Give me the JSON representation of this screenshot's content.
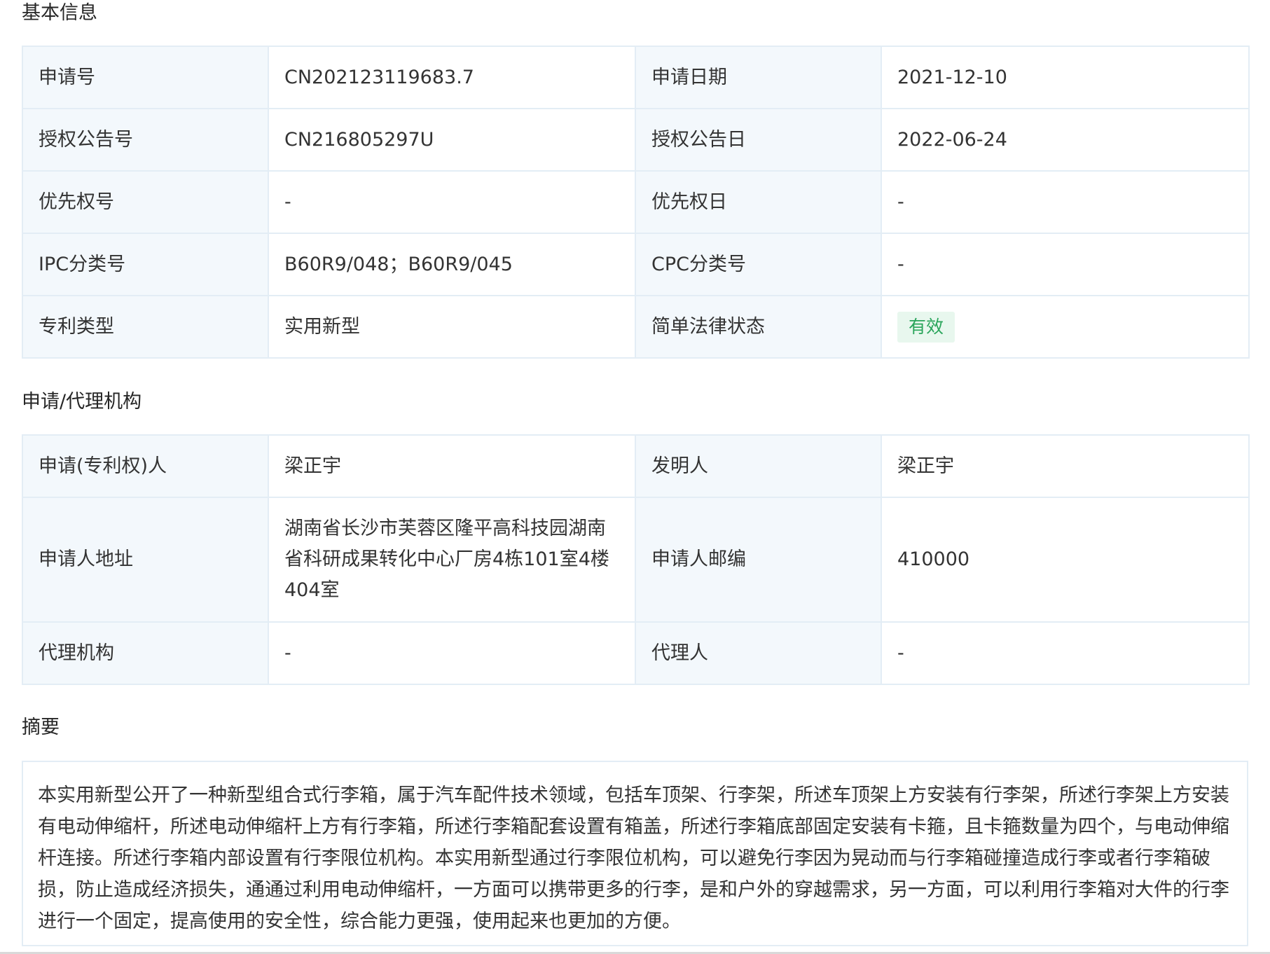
{
  "basic_info": {
    "title": "基本信息",
    "rows": [
      {
        "l1": "申请号",
        "v1": "CN202123119683.7",
        "l2": "申请日期",
        "v2": "2021-12-10"
      },
      {
        "l1": "授权公告号",
        "v1": "CN216805297U",
        "l2": "授权公告日",
        "v2": "2022-06-24"
      },
      {
        "l1": "优先权号",
        "v1": "-",
        "l2": "优先权日",
        "v2": "-"
      },
      {
        "l1": "IPC分类号",
        "v1": "B60R9/048；B60R9/045",
        "l2": "CPC分类号",
        "v2": "-"
      },
      {
        "l1": "专利类型",
        "v1": "实用新型",
        "l2": "简单法律状态",
        "v2": "有效"
      }
    ]
  },
  "agency_info": {
    "title": "申请/代理机构",
    "rows": [
      {
        "l1": "申请(专利权)人",
        "v1": "梁正宇",
        "l2": "发明人",
        "v2": "梁正宇"
      },
      {
        "l1": "申请人地址",
        "v1": "湖南省长沙市芙蓉区隆平高科技园湖南省科研成果转化中心厂房4栋101室4楼404室",
        "l2": "申请人邮编",
        "v2": "410000"
      },
      {
        "l1": "代理机构",
        "v1": "-",
        "l2": "代理人",
        "v2": "-"
      }
    ]
  },
  "abstract": {
    "title": "摘要",
    "text": "本实用新型公开了一种新型组合式行李箱，属于汽车配件技术领域，包括车顶架、行李架，所述车顶架上方安装有行李架，所述行李架上方安装有电动伸缩杆，所述电动伸缩杆上方有行李箱，所述行李箱配套设置有箱盖，所述行李箱底部固定安装有卡箍，且卡箍数量为四个，与电动伸缩杆连接。所述行李箱内部设置有行李限位机构。本实用新型通过行李限位机构，可以避免行李因为晃动而与行李箱碰撞造成行李或者行李箱破损，防止造成经济损失，通通过利用电动伸缩杆，一方面可以携带更多的行李，是和户外的穿越需求，另一方面，可以利用行李箱对大件的行李进行一个固定，提高使用的安全性，综合能力更强，使用起来也更加的方便。"
  },
  "colors": {
    "label_bg": "#f3f8fc",
    "border": "#e3edf5",
    "status_green": "#2aa55b",
    "status_bg": "#e8f7ee"
  }
}
